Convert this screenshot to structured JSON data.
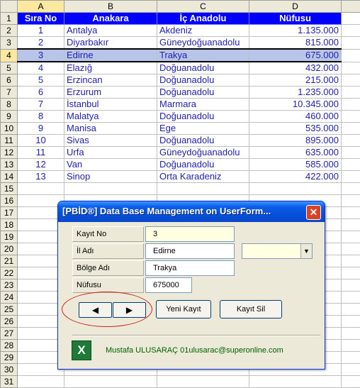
{
  "columns": [
    "A",
    "B",
    "C",
    "D"
  ],
  "header_row": {
    "row_num": "1",
    "cells": [
      "Sıra No",
      "Anakara",
      "İç Anadolu",
      "Nüfusu"
    ]
  },
  "rows": [
    {
      "row_num": "2",
      "cells": [
        "1",
        "Antalya",
        "Akdeniz",
        "1.135.000"
      ]
    },
    {
      "row_num": "3",
      "cells": [
        "2",
        "Diyarbakır",
        "Güneydoğuanadolu",
        "815.000"
      ]
    },
    {
      "row_num": "4",
      "cells": [
        "3",
        "Edirne",
        "Trakya",
        "675.000"
      ]
    },
    {
      "row_num": "5",
      "cells": [
        "4",
        "Elazığ",
        "Doğuanadolu",
        "432.000"
      ]
    },
    {
      "row_num": "6",
      "cells": [
        "5",
        "Erzincan",
        "Doğuanadolu",
        "215.000"
      ]
    },
    {
      "row_num": "7",
      "cells": [
        "6",
        "Erzurum",
        "Doğuanadolu",
        "1.235.000"
      ]
    },
    {
      "row_num": "8",
      "cells": [
        "7",
        "İstanbul",
        "Marmara",
        "10.345.000"
      ]
    },
    {
      "row_num": "9",
      "cells": [
        "8",
        "Malatya",
        "Doğuanadolu",
        "460.000"
      ]
    },
    {
      "row_num": "10",
      "cells": [
        "9",
        "Manisa",
        "Ege",
        "535.000"
      ]
    },
    {
      "row_num": "11",
      "cells": [
        "10",
        "Sivas",
        "Doğuanadolu",
        "895.000"
      ]
    },
    {
      "row_num": "12",
      "cells": [
        "11",
        "Urfa",
        "Güneydoğuanadolu",
        "635.000"
      ]
    },
    {
      "row_num": "13",
      "cells": [
        "12",
        "Van",
        "Doğuanadolu",
        "585.000"
      ]
    },
    {
      "row_num": "14",
      "cells": [
        "13",
        "Sinop",
        "Orta Karadeniz",
        "422.000"
      ]
    }
  ],
  "empty_rows": [
    "15",
    "16",
    "17",
    "18",
    "19",
    "20",
    "21",
    "22",
    "23",
    "24",
    "25",
    "26",
    "27",
    "28",
    "29",
    "30",
    "31"
  ],
  "selected_row": "4",
  "dialog": {
    "title": "[PBİD®] Data Base Management on UserForm...",
    "close_symbol": "✕",
    "labels": {
      "kayit_no": "Kayıt No",
      "il_adi": "İl Adı",
      "bolge_adi": "Bölge Adı",
      "nufusu": "Nüfusu"
    },
    "values": {
      "kayit_no": "3",
      "il_adi": "Edirne",
      "bolge_adi": "Trakya",
      "nufusu": "675000"
    },
    "combo_value": "",
    "prev_symbol": "◀",
    "next_symbol": "▶",
    "new_record_label": "Yeni Kayıt",
    "delete_record_label": "Kayıt Sil",
    "excel_logo_letter": "X",
    "footer": "Mustafa ULUSARAÇ 01ulusarac@superonline.com"
  },
  "colors": {
    "header_bg": "#0000ff",
    "selected_bg": "#b7c6e8",
    "titlebar": "#0451dd",
    "text": "#1f1fa8"
  }
}
